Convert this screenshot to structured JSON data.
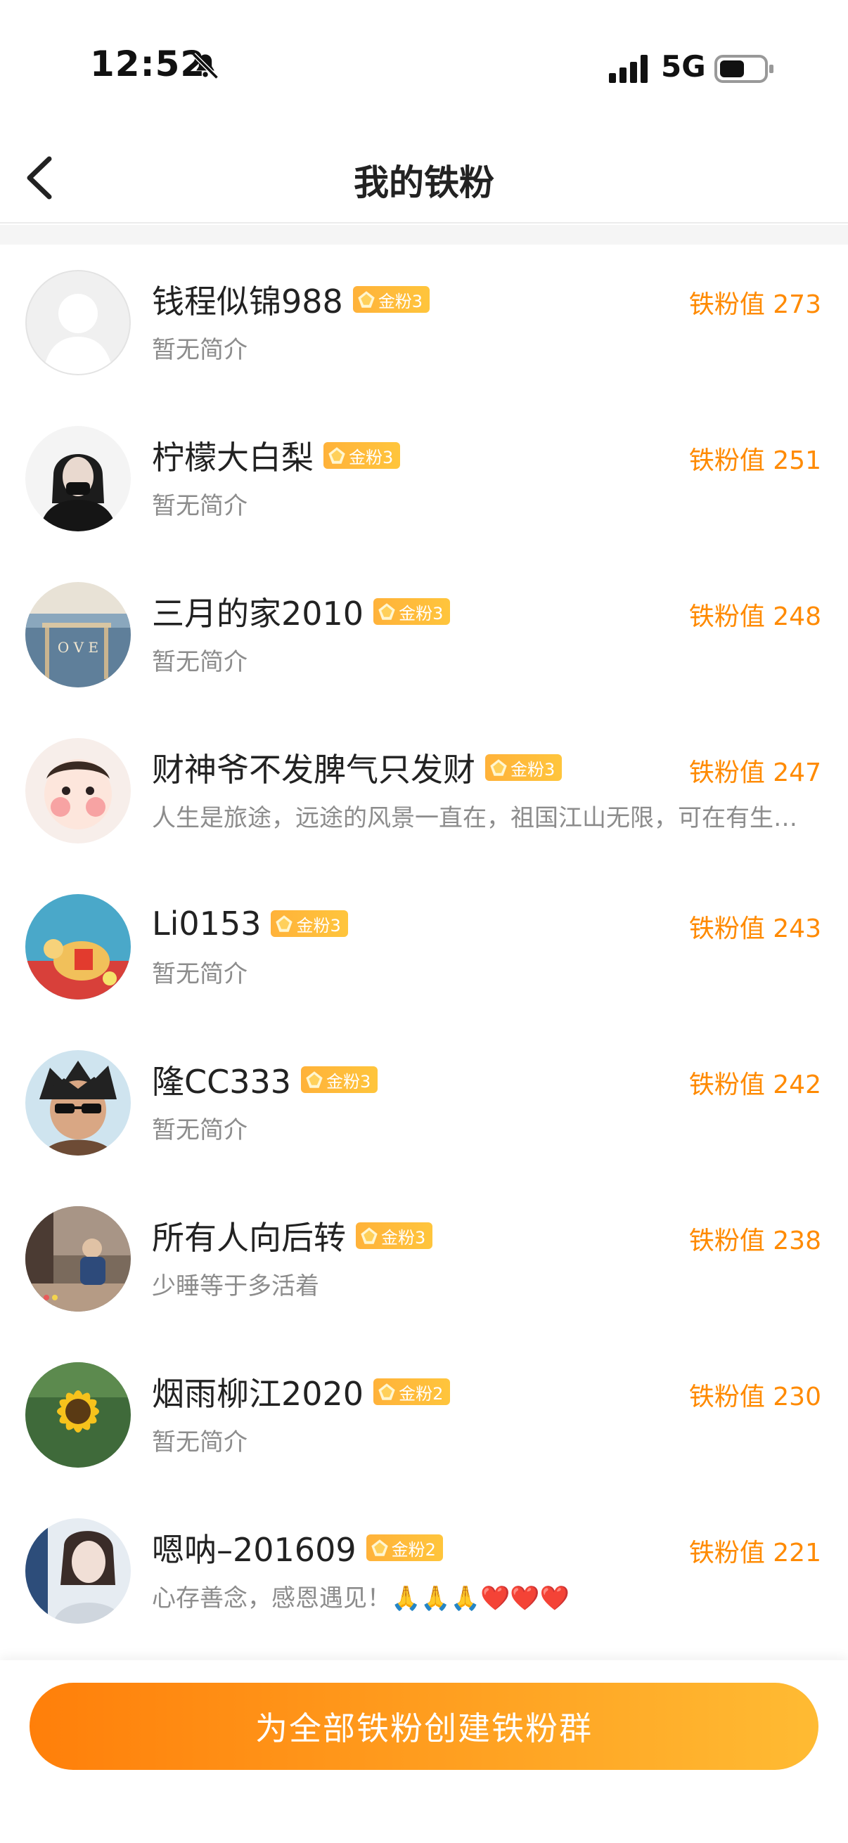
{
  "status_bar": {
    "time": "12:52",
    "network": "5G"
  },
  "nav": {
    "title": "我的铁粉"
  },
  "fans": [
    {
      "name": "钱程似锦988",
      "badge": "金粉3",
      "value": "铁粉值 273",
      "bio": "暂无简介",
      "avatar": "default-avatar"
    },
    {
      "name": "柠檬大白梨",
      "badge": "金粉3",
      "value": "铁粉值 251",
      "bio": "暂无简介",
      "avatar": "woman-portrait"
    },
    {
      "name": "三月的家2010",
      "badge": "金粉3",
      "value": "铁粉值 248",
      "bio": "暂无简介",
      "avatar": "seaside-photo"
    },
    {
      "name": "财神爷不发脾气只发财",
      "badge": "金粉3",
      "value": "铁粉值 247",
      "bio": "人生是旅途，远途的风景一直在，祖国江山无限，可在有生之年",
      "avatar": "cartoon-baby"
    },
    {
      "name": "Li0153",
      "badge": "金粉3",
      "value": "铁粉值 243",
      "bio": "暂无简介",
      "avatar": "fortune-horse"
    },
    {
      "name": "隆CC333",
      "badge": "金粉3",
      "value": "铁粉值 242",
      "bio": "暂无简介",
      "avatar": "anime-sunglasses"
    },
    {
      "name": "所有人向后转",
      "badge": "金粉3",
      "value": "铁粉值 238",
      "bio": "少睡等于多活着",
      "avatar": "street-photo"
    },
    {
      "name": "烟雨柳江2020",
      "badge": "金粉2",
      "value": "铁粉值 230",
      "bio": "暂无简介",
      "avatar": "sunflower"
    },
    {
      "name": "嗯呐–201609",
      "badge": "金粉2",
      "value": "铁粉值 221",
      "bio": "心存善念，感恩遇见！🙏🙏🙏❤️❤️❤️",
      "avatar": "girl-portrait"
    }
  ],
  "bottom": {
    "cta_label": "为全部铁粉创建铁粉群"
  },
  "colors": {
    "accent": "#ff8a00",
    "badge": "#ffb23a",
    "cta_start": "#ff7f0a",
    "cta_end": "#ffbb33"
  }
}
